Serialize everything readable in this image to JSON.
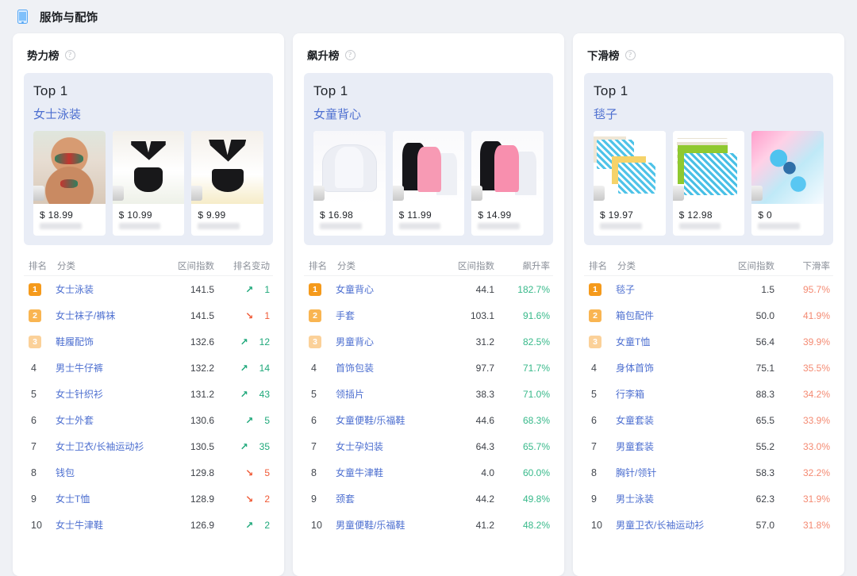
{
  "header": {
    "icon": "tablet-device-icon",
    "title": "服饰与配饰"
  },
  "columns_generic": {
    "rank": "排名",
    "category": "分类",
    "index": "区间指数"
  },
  "top_label": "Top 1",
  "currency_symbol": "$",
  "boards": [
    {
      "id": "power-board",
      "title": "势力榜",
      "help": "?",
      "top": {
        "rank_label": "Top 1",
        "category": "女士泳装",
        "products": [
          {
            "price": "$ 18.99",
            "art": "a-swim1"
          },
          {
            "price": "$ 10.99",
            "art": "a-swim2"
          },
          {
            "price": "$ 9.99",
            "art": "a-swim3"
          }
        ]
      },
      "table": {
        "headers": [
          "排名",
          "分类",
          "区间指数",
          "排名变动"
        ],
        "rows": [
          {
            "rank": "1",
            "badge": "b1",
            "category": "女士泳装",
            "index": "141.5",
            "dir": "up",
            "change": "1"
          },
          {
            "rank": "2",
            "badge": "b2",
            "category": "女士袜子/裤袜",
            "index": "141.5",
            "dir": "down",
            "change": "1"
          },
          {
            "rank": "3",
            "badge": "b3",
            "category": "鞋履配饰",
            "index": "132.6",
            "dir": "up",
            "change": "12"
          },
          {
            "rank": "4",
            "badge": "",
            "category": "男士牛仔裤",
            "index": "132.2",
            "dir": "up",
            "change": "14"
          },
          {
            "rank": "5",
            "badge": "",
            "category": "女士针织衫",
            "index": "131.2",
            "dir": "up",
            "change": "43"
          },
          {
            "rank": "6",
            "badge": "",
            "category": "女士外套",
            "index": "130.6",
            "dir": "up",
            "change": "5"
          },
          {
            "rank": "7",
            "badge": "",
            "category": "女士卫衣/长袖运动衫",
            "index": "130.5",
            "dir": "up",
            "change": "35"
          },
          {
            "rank": "8",
            "badge": "",
            "category": "钱包",
            "index": "129.8",
            "dir": "down",
            "change": "5"
          },
          {
            "rank": "9",
            "badge": "",
            "category": "女士T恤",
            "index": "128.9",
            "dir": "down",
            "change": "2"
          },
          {
            "rank": "10",
            "badge": "",
            "category": "女士牛津鞋",
            "index": "126.9",
            "dir": "up",
            "change": "2"
          }
        ]
      }
    },
    {
      "id": "rising-board",
      "title": "飙升榜",
      "help": "?",
      "top": {
        "rank_label": "Top 1",
        "category": "女童背心",
        "products": [
          {
            "price": "$ 16.98",
            "art": "a-tank1"
          },
          {
            "price": "$ 11.99",
            "art": "a-tank2"
          },
          {
            "price": "$ 14.99",
            "art": "a-tank3"
          }
        ]
      },
      "table": {
        "headers": [
          "排名",
          "分类",
          "区间指数",
          "飙升率"
        ],
        "rows": [
          {
            "rank": "1",
            "badge": "b1",
            "category": "女童背心",
            "index": "44.1",
            "pct": "182.7%"
          },
          {
            "rank": "2",
            "badge": "b2",
            "category": "手套",
            "index": "103.1",
            "pct": "91.6%"
          },
          {
            "rank": "3",
            "badge": "b3",
            "category": "男童背心",
            "index": "31.2",
            "pct": "82.5%"
          },
          {
            "rank": "4",
            "badge": "",
            "category": "首饰包装",
            "index": "97.7",
            "pct": "71.7%"
          },
          {
            "rank": "5",
            "badge": "",
            "category": "领插片",
            "index": "38.3",
            "pct": "71.0%"
          },
          {
            "rank": "6",
            "badge": "",
            "category": "女童便鞋/乐福鞋",
            "index": "44.6",
            "pct": "68.3%"
          },
          {
            "rank": "7",
            "badge": "",
            "category": "女士孕妇装",
            "index": "64.3",
            "pct": "65.7%"
          },
          {
            "rank": "8",
            "badge": "",
            "category": "女童牛津鞋",
            "index": "4.0",
            "pct": "60.0%"
          },
          {
            "rank": "9",
            "badge": "",
            "category": "颈套",
            "index": "44.2",
            "pct": "49.8%"
          },
          {
            "rank": "10",
            "badge": "",
            "category": "男童便鞋/乐福鞋",
            "index": "41.2",
            "pct": "48.2%"
          }
        ]
      }
    },
    {
      "id": "declining-board",
      "title": "下滑榜",
      "help": "?",
      "top": {
        "rank_label": "Top 1",
        "category": "毯子",
        "products": [
          {
            "price": "$ 19.97",
            "art": "a-blk1"
          },
          {
            "price": "$ 12.98",
            "art": "a-blk2"
          },
          {
            "price": "$ 0",
            "art": "a-blk3"
          }
        ]
      },
      "table": {
        "headers": [
          "排名",
          "分类",
          "区间指数",
          "下滑率"
        ],
        "rows": [
          {
            "rank": "1",
            "badge": "b1",
            "category": "毯子",
            "index": "1.5",
            "pct": "95.7%"
          },
          {
            "rank": "2",
            "badge": "b2",
            "category": "箱包配件",
            "index": "50.0",
            "pct": "41.9%"
          },
          {
            "rank": "3",
            "badge": "b3",
            "category": "女童T恤",
            "index": "56.4",
            "pct": "39.9%"
          },
          {
            "rank": "4",
            "badge": "",
            "category": "身体首饰",
            "index": "75.1",
            "pct": "35.5%"
          },
          {
            "rank": "5",
            "badge": "",
            "category": "行李箱",
            "index": "88.3",
            "pct": "34.2%"
          },
          {
            "rank": "6",
            "badge": "",
            "category": "女童套装",
            "index": "65.5",
            "pct": "33.9%"
          },
          {
            "rank": "7",
            "badge": "",
            "category": "男童套装",
            "index": "55.2",
            "pct": "33.0%"
          },
          {
            "rank": "8",
            "badge": "",
            "category": "胸针/领针",
            "index": "58.3",
            "pct": "32.2%"
          },
          {
            "rank": "9",
            "badge": "",
            "category": "男士泳装",
            "index": "62.3",
            "pct": "31.9%"
          },
          {
            "rank": "10",
            "badge": "",
            "category": "男童卫衣/长袖运动衫",
            "index": "57.0",
            "pct": "31.8%"
          }
        ]
      }
    }
  ],
  "colors": {
    "page_bg": "#eff1f5",
    "card_bg": "#ffffff",
    "top_panel_bg": "#e9edf6",
    "link": "#4d6fd0",
    "badge_1": "#f59a1b",
    "badge_2": "#f9b552",
    "badge_3": "#fbd199",
    "up": "#1ea87a",
    "down": "#f05a36",
    "pct_up": "#37b98a",
    "pct_down": "#f48a72"
  }
}
